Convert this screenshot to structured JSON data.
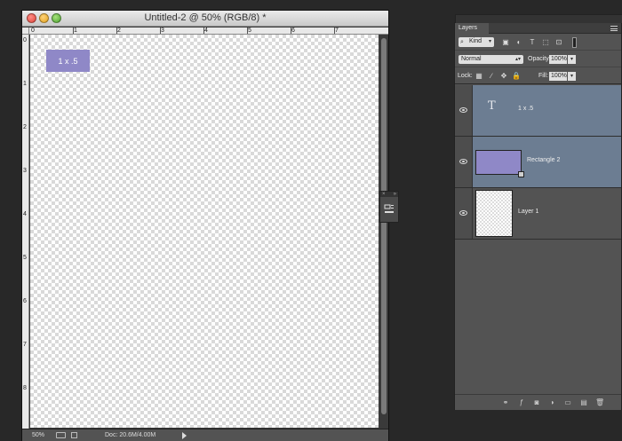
{
  "document": {
    "title": "Untitled-2 @ 50% (RGB/8) *",
    "ruler_top_labels": [
      "0",
      "1",
      "2",
      "3",
      "4",
      "5",
      "6",
      "7"
    ],
    "ruler_left_labels": [
      "0",
      "1",
      "2",
      "3",
      "4",
      "5",
      "6",
      "7",
      "8"
    ],
    "shape_label": "1 x .5",
    "status": {
      "zoom": "50%",
      "doc_size": "Doc: 20.6M/4.00M"
    }
  },
  "layers_panel": {
    "tab_label": "Layers",
    "filter_kind": "Kind",
    "blend_mode": "Normal",
    "opacity_label": "Opacity:",
    "opacity_value": "100%",
    "lock_label": "Lock:",
    "fill_label": "Fill:",
    "fill_value": "100%",
    "layers": [
      {
        "name": "1 x .5",
        "kind": "text",
        "selected": true
      },
      {
        "name": "Rectangle 2",
        "kind": "shape",
        "selected": true
      },
      {
        "name": "Layer 1",
        "kind": "pixel",
        "selected": false
      }
    ]
  },
  "colors": {
    "shape_fill": "#8f88c7",
    "selection": "#6c7d92",
    "panel_bg": "#535353"
  }
}
